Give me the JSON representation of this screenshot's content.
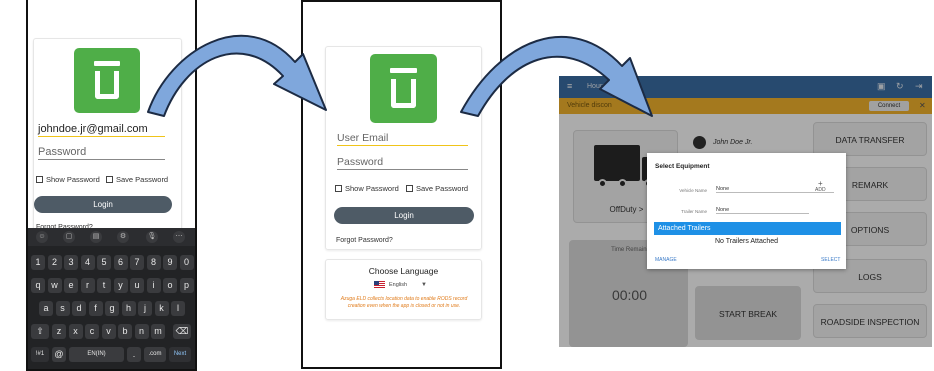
{
  "panel1": {
    "email": "johndoe.jr@gmail.com",
    "password_placeholder": "Password",
    "show_password": "Show Password",
    "save_password": "Save Password",
    "login": "Login",
    "forgot": "Forgot Password?",
    "keyboard": {
      "rows": [
        [
          "1",
          "2",
          "3",
          "4",
          "5",
          "6",
          "7",
          "8",
          "9",
          "0"
        ],
        [
          "q",
          "w",
          "e",
          "r",
          "t",
          "y",
          "u",
          "i",
          "o",
          "p"
        ],
        [
          "a",
          "s",
          "d",
          "f",
          "g",
          "h",
          "j",
          "k",
          "l"
        ],
        [
          "z",
          "x",
          "c",
          "v",
          "b",
          "n",
          "m"
        ]
      ],
      "symbols": "!#1",
      "at": "@",
      "space": "EN(IN)",
      "period": ".",
      "dotcom": ".com",
      "next": "Next",
      "shift": "⇧",
      "backspace": "⌫",
      "toolbar": [
        "☺",
        "▢",
        "▤",
        "⚙",
        "🎙",
        "⋯"
      ]
    }
  },
  "panel2": {
    "email_placeholder": "User Email",
    "password_placeholder": "Password",
    "show_password": "Show Password",
    "save_password": "Save Password",
    "login": "Login",
    "forgot": "Forgot Password?",
    "choose_language": "Choose Language",
    "language": "English",
    "notice": "Azuga ELD collects location data to enable RODS record creation even when the app is closed or not in use."
  },
  "panel3": {
    "app_title": "Hours of",
    "banner_text": "Vehicle discon",
    "connect": "Connect",
    "close": "✕",
    "driver_name": "John Doe Jr.",
    "status": "OffDuty",
    "status_arrow": ">",
    "time_label": "Time Remaini",
    "time_value": "00:00",
    "buttons": [
      "DATA TRANSFER",
      "REMARK",
      "OPTIONS",
      "LOGS",
      "ROADSIDE INSPECTION"
    ],
    "start_break": "START BREAK",
    "dialog": {
      "title": "Select Equipment",
      "vehicle_label": "Vehicle Name",
      "vehicle_value": "None",
      "trailer_label": "Trailer Name",
      "trailer_value": "None",
      "add_symbol": "+",
      "add": "ADD",
      "attached": "Attached Trailers",
      "none_attached": "No Trailers Attached",
      "manage": "MANAGE",
      "select": "SELECT"
    }
  },
  "colors": {
    "brand_green": "#4fae48",
    "login_button": "#4e5b66",
    "app_bar": "#3b6fa6",
    "banner": "#f5b52e",
    "attached_header": "#1e90e6",
    "arrow_fill": "#7fa7dc"
  }
}
